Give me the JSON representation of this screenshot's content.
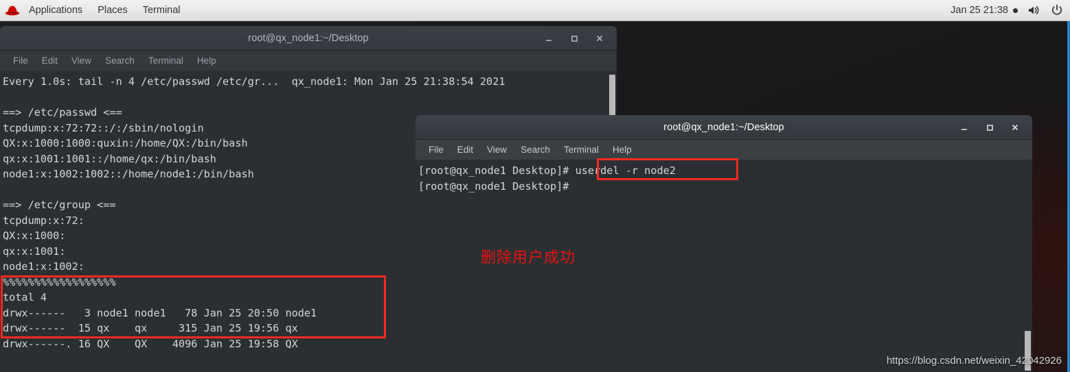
{
  "topbar": {
    "logo_icon": "redhat-logo-icon",
    "items": [
      {
        "label": "Applications"
      },
      {
        "label": "Places"
      },
      {
        "label": "Terminal"
      }
    ],
    "clock": "Jan 25  21:38",
    "recording_dot": "●",
    "volume_icon": "volume-icon",
    "power_icon": "power-icon"
  },
  "window1": {
    "title": "root@qx_node1:~/Desktop",
    "menu": [
      {
        "label": "File"
      },
      {
        "label": "Edit"
      },
      {
        "label": "View"
      },
      {
        "label": "Search"
      },
      {
        "label": "Terminal"
      },
      {
        "label": "Help"
      }
    ],
    "buttons": {
      "minimize": "minimize-icon",
      "maximize": "maximize-icon",
      "close": "close-icon"
    },
    "lines": [
      "Every 1.0s: tail -n 4 /etc/passwd /etc/gr...  qx_node1: Mon Jan 25 21:38:54 2021",
      "",
      "==> /etc/passwd <==",
      "tcpdump:x:72:72::/:/sbin/nologin",
      "QX:x:1000:1000:quxin:/home/QX:/bin/bash",
      "qx:x:1001:1001::/home/qx:/bin/bash",
      "node1:x:1002:1002::/home/node1:/bin/bash",
      "",
      "==> /etc/group <==",
      "tcpdump:x:72:",
      "QX:x:1000:",
      "qx:x:1001:",
      "node1:x:1002:",
      "%%%%%%%%%%%%%%%%%%",
      "total 4",
      "drwx------   3 node1 node1   78 Jan 25 20:50 node1",
      "drwx------  15 qx    qx     315 Jan 25 19:56 qx",
      "drwx------. 16 QX    QX    4096 Jan 25 19:58 QX"
    ]
  },
  "window2": {
    "title": "root@qx_node1:~/Desktop",
    "menu": [
      {
        "label": "File"
      },
      {
        "label": "Edit"
      },
      {
        "label": "View"
      },
      {
        "label": "Search"
      },
      {
        "label": "Terminal"
      },
      {
        "label": "Help"
      }
    ],
    "buttons": {
      "minimize": "minimize-icon",
      "maximize": "maximize-icon",
      "close": "close-icon"
    },
    "lines": [
      "[root@qx_node1 Desktop]# userdel -r node2",
      "[root@qx_node1 Desktop]#"
    ]
  },
  "annotations": {
    "note_cn": "删除用户成功",
    "highlight_color": "#ff2a22",
    "note_color": "#e8120f"
  },
  "watermark": {
    "text": "https://blog.csdn.net/weixin_42042926"
  }
}
